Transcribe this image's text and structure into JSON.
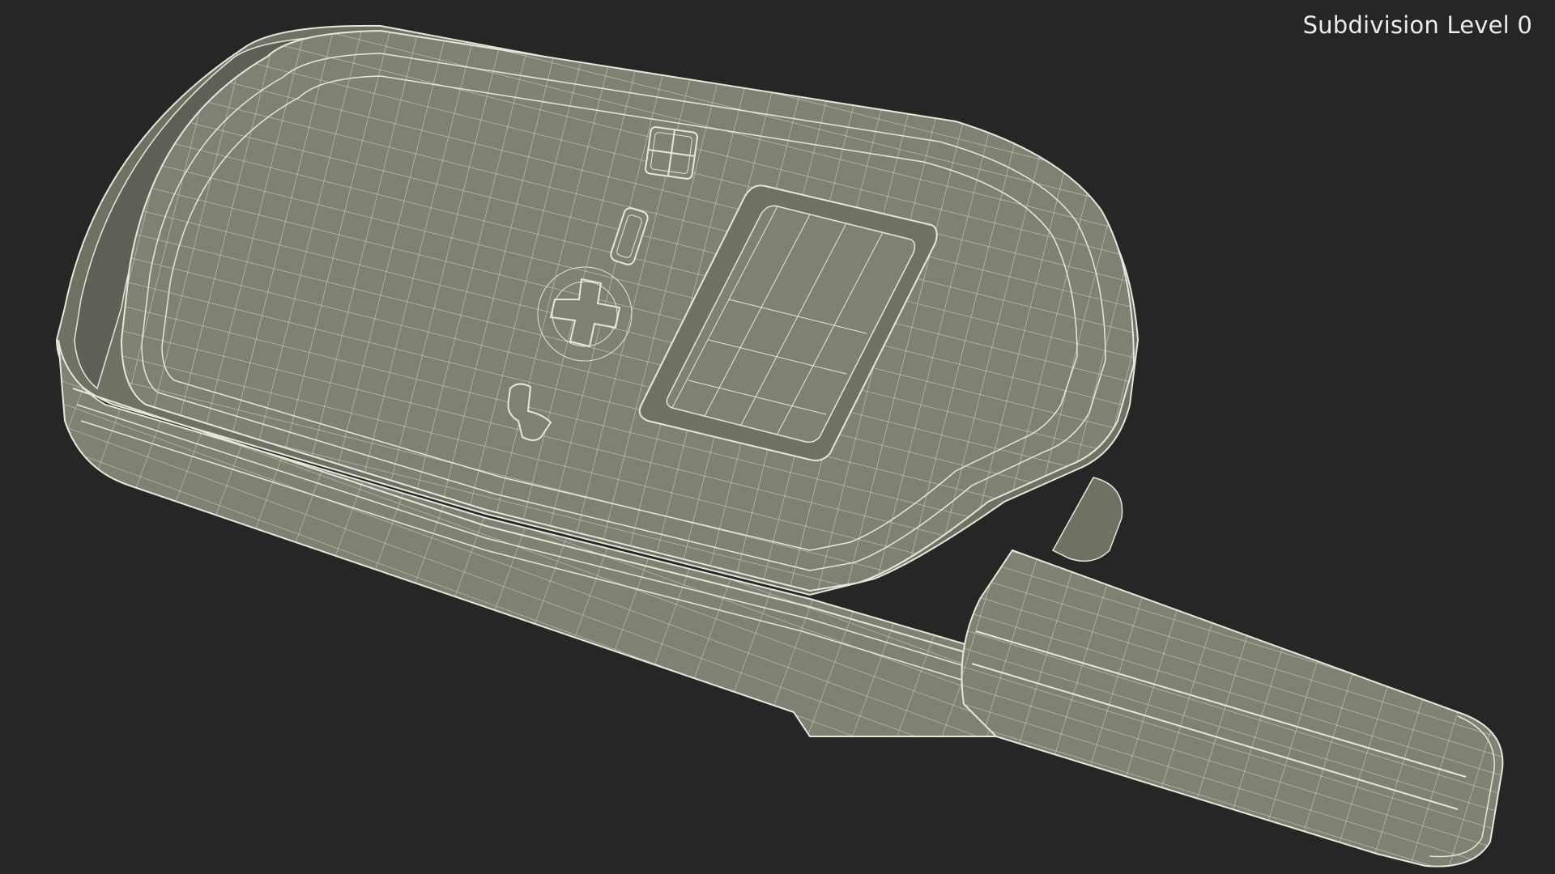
{
  "overlay": {
    "level_label": "Subdivision Level 0"
  },
  "colors": {
    "background": "#262626",
    "surface": "#7f8172",
    "surface_dark": "#6f7163",
    "surface_shadow": "#5e6055",
    "wire": "#e6e6dc",
    "label_text": "#ececec"
  }
}
